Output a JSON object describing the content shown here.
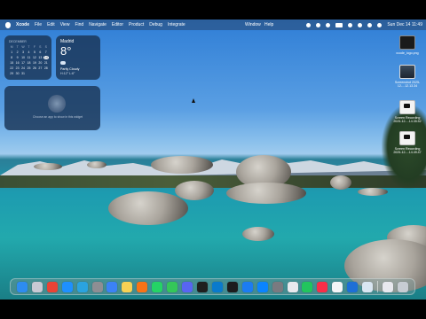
{
  "menubar": {
    "app_name": "Xcode",
    "menus": [
      "File",
      "Edit",
      "View",
      "Find",
      "Navigate",
      "Editor",
      "Product",
      "Debug",
      "Integrate",
      "Window",
      "Help"
    ],
    "datetime": "Sun Dec 14 11:49"
  },
  "widgets": {
    "calendar": {
      "month": "DECEMBER",
      "weekdays": [
        "M",
        "T",
        "W",
        "T",
        "F",
        "S",
        "S"
      ],
      "days": [
        "1",
        "2",
        "3",
        "4",
        "5",
        "6",
        "7",
        "8",
        "9",
        "10",
        "11",
        "12",
        "13",
        "14",
        "15",
        "16",
        "17",
        "18",
        "19",
        "20",
        "21",
        "22",
        "23",
        "24",
        "25",
        "26",
        "27",
        "28",
        "29",
        "30",
        "31"
      ],
      "today": "14"
    },
    "weather": {
      "city": "Madrid",
      "temperature": "8°",
      "condition": "Partly Cloudy",
      "high_low": "H:12° L:6°"
    },
    "placeholder": {
      "message": "Choose an app to show in this widget"
    }
  },
  "desktop_icons": [
    {
      "label": "xcode_logo.png",
      "icon": "xcode-logo-thumbnail"
    },
    {
      "label": "Screenshot 2025-12-...12.13.34",
      "icon": "screenshot-thumbnail"
    },
    {
      "label": "Screen Recording 2025-12-...14.35.52",
      "icon": "video-thumbnail"
    },
    {
      "label": "Screen Recording 2025-12-...14.49.47",
      "icon": "video-thumbnail"
    }
  ],
  "dock": {
    "apps": [
      {
        "name": "finder",
        "color": "#2d8cf0"
      },
      {
        "name": "launchpad",
        "color": "#c9c9d3"
      },
      {
        "name": "chrome",
        "color": "#ea4335"
      },
      {
        "name": "safari",
        "color": "#1e90ff"
      },
      {
        "name": "telegram",
        "color": "#2aa3df"
      },
      {
        "name": "settings",
        "color": "#8e8e93"
      },
      {
        "name": "mail",
        "color": "#3b82f6"
      },
      {
        "name": "notes",
        "color": "#f7d154"
      },
      {
        "name": "sublime",
        "color": "#f97316"
      },
      {
        "name": "whatsapp",
        "color": "#25d366"
      },
      {
        "name": "messages",
        "color": "#34c759"
      },
      {
        "name": "discord",
        "color": "#5865f2"
      },
      {
        "name": "unity",
        "color": "#1f1f1f"
      },
      {
        "name": "vscode",
        "color": "#0a7acc"
      },
      {
        "name": "terminal",
        "color": "#1c1c1e"
      },
      {
        "name": "xcode",
        "color": "#1c7cf2"
      },
      {
        "name": "app-store",
        "color": "#0a84ff"
      },
      {
        "name": "system-tool",
        "color": "#7a7a80"
      },
      {
        "name": "utility",
        "color": "#e9e9ee"
      },
      {
        "name": "numbers",
        "color": "#22c55e"
      },
      {
        "name": "music",
        "color": "#fa2d48"
      },
      {
        "name": "calendar",
        "color": "#f5f5f7"
      },
      {
        "name": "quicktime",
        "color": "#1d6fd6"
      },
      {
        "name": "preview",
        "color": "#d9e6f2"
      }
    ],
    "trailing": [
      {
        "name": "documents-stack",
        "color": "#e8e8ee"
      },
      {
        "name": "trash",
        "color": "#c7ccd3"
      }
    ]
  }
}
